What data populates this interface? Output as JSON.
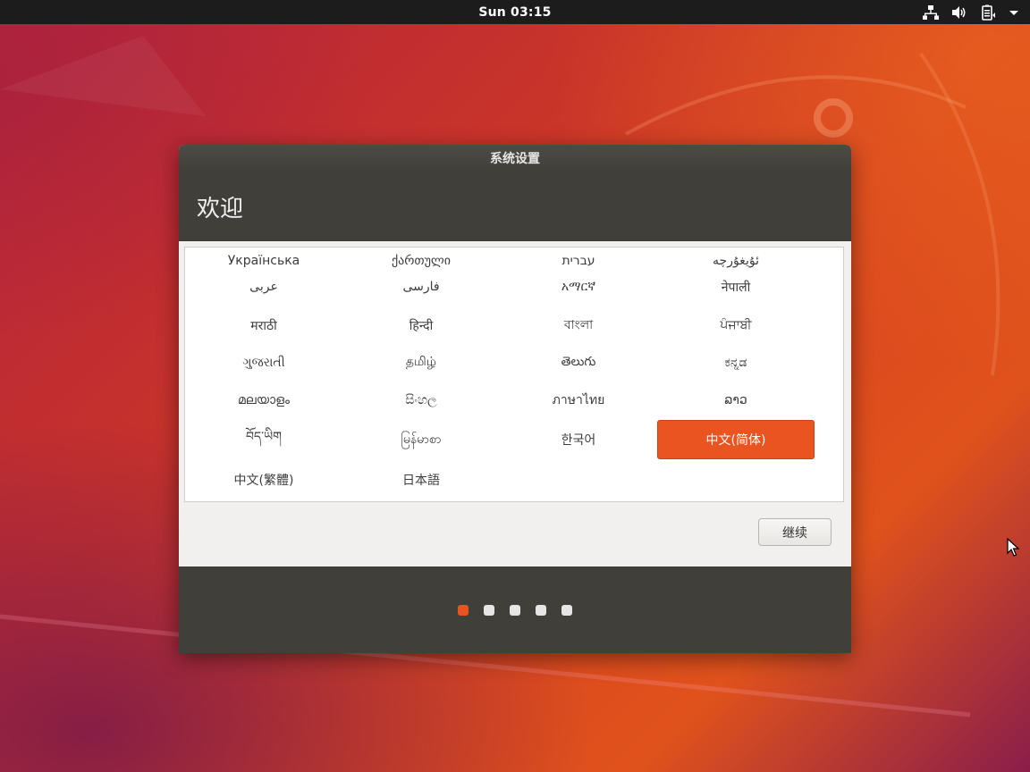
{
  "topbar": {
    "clock": "Sun 03:15",
    "icons": [
      "network-icon",
      "volume-icon",
      "battery-icon",
      "system-menu-arrow-icon"
    ]
  },
  "dialog": {
    "title": "系统设置",
    "heading": "欢迎",
    "continue_label": "继续",
    "languages": [
      [
        "Українська",
        "ქართული",
        "עברית",
        "ئۇيغۇرچە"
      ],
      [
        "عربى",
        "فارسی",
        "አማርኛ",
        "नेपाली"
      ],
      [
        "मराठी",
        "हिन्दी",
        "বাংলা",
        "ਪੰਜਾਬੀ"
      ],
      [
        "ગુજરાતી",
        "தமிழ்",
        "తెలుగు",
        "ಕನ್ನಡ"
      ],
      [
        "മലയാളം",
        "සිංහල",
        "ภาษาไทย",
        "ລາວ"
      ],
      [
        "བོད་ཡིག",
        "မြန်မာစာ",
        "한국어",
        "中文(简体)"
      ],
      [
        "中文(繁體)",
        "日本語"
      ]
    ],
    "selected_language": "中文(简体)",
    "pager": {
      "pages": 5,
      "current": 1
    }
  },
  "colors": {
    "accent": "#e95420",
    "dialog_dark": "#403f3a",
    "topbar": "#1c1c1c"
  }
}
